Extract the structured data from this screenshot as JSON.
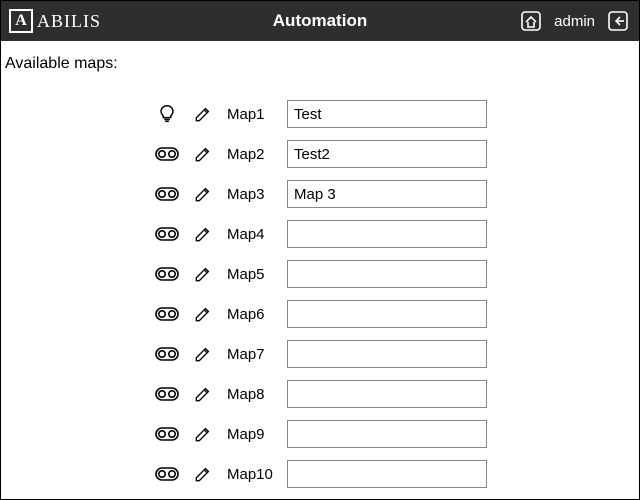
{
  "header": {
    "logo_mark": "A",
    "logo_text": "ABILIS",
    "title": "Automation",
    "user": "admin"
  },
  "section_label": "Available maps:",
  "maps": [
    {
      "type": "bulb",
      "label": "Map1",
      "value": "Test"
    },
    {
      "type": "toggle",
      "label": "Map2",
      "value": "Test2"
    },
    {
      "type": "toggle",
      "label": "Map3",
      "value": "Map 3"
    },
    {
      "type": "toggle",
      "label": "Map4",
      "value": ""
    },
    {
      "type": "toggle",
      "label": "Map5",
      "value": ""
    },
    {
      "type": "toggle",
      "label": "Map6",
      "value": ""
    },
    {
      "type": "toggle",
      "label": "Map7",
      "value": ""
    },
    {
      "type": "toggle",
      "label": "Map8",
      "value": ""
    },
    {
      "type": "toggle",
      "label": "Map9",
      "value": ""
    },
    {
      "type": "toggle",
      "label": "Map10",
      "value": ""
    }
  ]
}
